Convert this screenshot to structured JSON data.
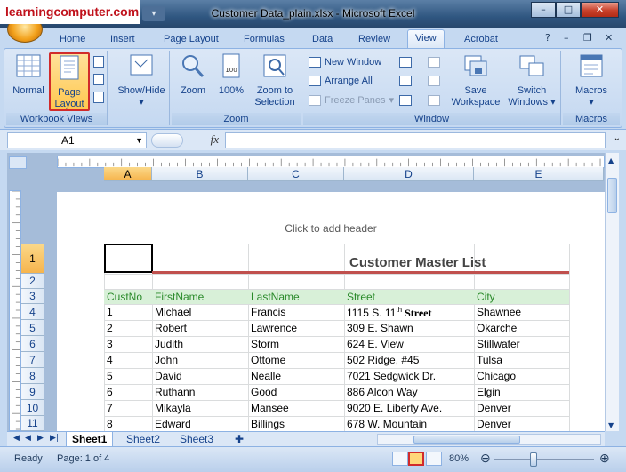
{
  "watermark": "learningcomputer.com",
  "window": {
    "title": "Customer Data_plain.xlsx - Microsoft Excel"
  },
  "ribbon_tabs": [
    "Home",
    "Insert",
    "Page Layout",
    "Formulas",
    "Data",
    "Review",
    "View",
    "Acrobat"
  ],
  "active_tab": "View",
  "ribbon": {
    "workbook_views": {
      "label": "Workbook Views",
      "normal": "Normal",
      "page_layout_1": "Page",
      "page_layout_2": "Layout"
    },
    "show_hide": {
      "label_1": "Show/Hide"
    },
    "zoom": {
      "label": "Zoom",
      "zoom": "Zoom",
      "hundred": "100%",
      "to_selection_1": "Zoom to",
      "to_selection_2": "Selection"
    },
    "window": {
      "label": "Window",
      "new_window": "New Window",
      "arrange_all": "Arrange All",
      "freeze_panes": "Freeze Panes",
      "save_ws_1": "Save",
      "save_ws_2": "Workspace",
      "switch_1": "Switch",
      "switch_2": "Windows"
    },
    "macros": {
      "label": "Macros",
      "macros": "Macros"
    }
  },
  "formula_bar": {
    "name_box": "A1",
    "fx": "fx",
    "value": ""
  },
  "columns": [
    "A",
    "B",
    "C",
    "D",
    "E"
  ],
  "selected_column": "A",
  "header_hint": "Click to add header",
  "title_cell": "Customer Master List",
  "row_numbers": [
    "1",
    "2",
    "3",
    "4",
    "5",
    "6",
    "7",
    "8",
    "9",
    "10",
    "11"
  ],
  "table_header": [
    "CustNo",
    "FirstName",
    "LastName",
    "Street",
    "City"
  ],
  "rows": [
    [
      "1",
      "Michael",
      "Francis",
      "1115 S. 11",
      "Shawnee"
    ],
    [
      "2",
      "Robert",
      "Lawrence",
      "309 E. Shawn",
      "Okarche"
    ],
    [
      "3",
      "Judith",
      "Storm",
      "624 E. View",
      "Stillwater"
    ],
    [
      "4",
      "John",
      "Ottome",
      "502 Ridge, #45",
      "Tulsa"
    ],
    [
      "5",
      "David",
      "Nealle",
      "7021 Sedgwick Dr.",
      "Chicago"
    ],
    [
      "6",
      "Ruthann",
      "Good",
      "886 Alcon Way",
      "Elgin"
    ],
    [
      "7",
      "Mikayla",
      "Mansee",
      "9020 E. Liberty Ave.",
      "Denver"
    ],
    [
      "8",
      "Edward",
      "Billings",
      "678 W. Mountain",
      "Denver"
    ]
  ],
  "street_row1_sup": "th",
  "street_row1_tail": " Street",
  "sheet_tabs": [
    "Sheet1",
    "Sheet2",
    "Sheet3"
  ],
  "active_sheet": "Sheet1",
  "status": {
    "ready": "Ready",
    "page": "Page: 1 of 4",
    "zoom": "80%"
  },
  "colors": {
    "title_rule": "#c0504d",
    "header_fill": "#d8f0d8",
    "header_text": "#2a8a2a"
  }
}
